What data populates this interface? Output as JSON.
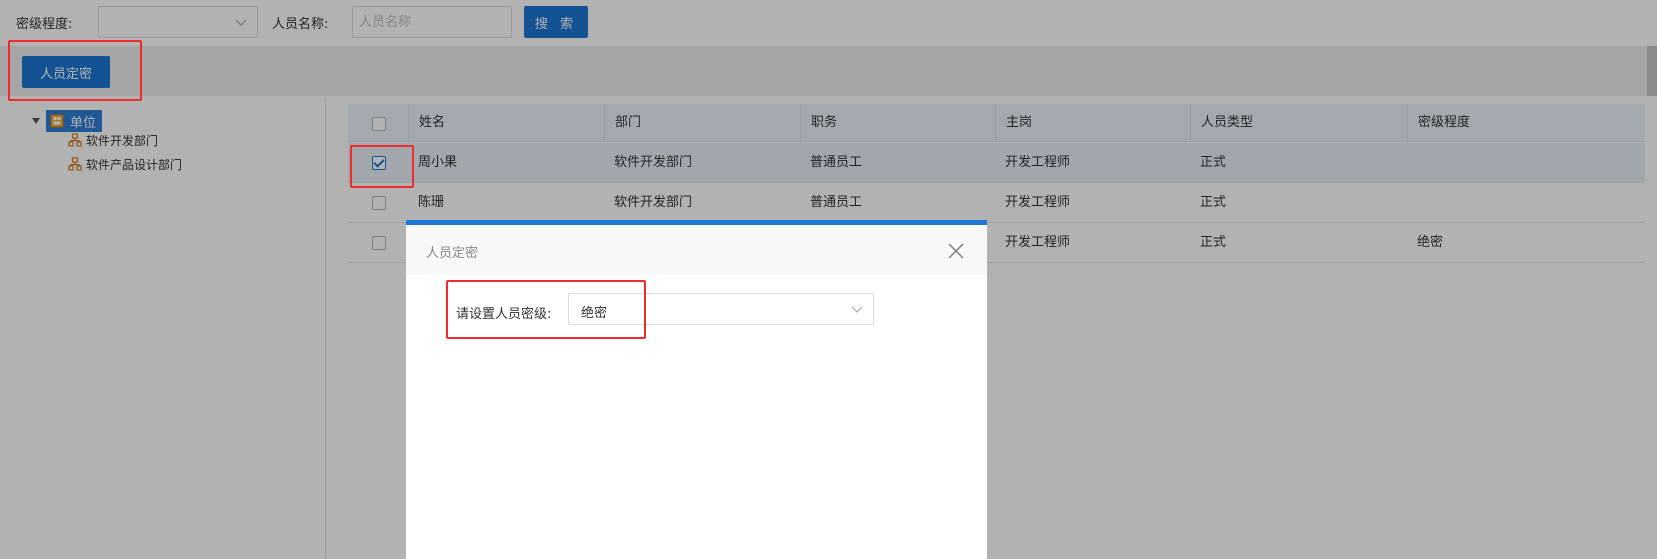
{
  "search": {
    "level_label": "密级程度:",
    "level_value": "",
    "name_label": "人员名称:",
    "name_placeholder": "人员名称",
    "search_button": "搜 索"
  },
  "toolbar": {
    "assign_button": "人员定密"
  },
  "tree": {
    "root_label": "单位",
    "children": [
      "软件开发部门",
      "软件产品设计部门"
    ]
  },
  "table": {
    "columns": [
      "姓名",
      "部门",
      "职务",
      "主岗",
      "人员类型",
      "密级程度"
    ],
    "rows": [
      {
        "checked": true,
        "cells": [
          "周小果",
          "软件开发部门",
          "普通员工",
          "开发工程师",
          "正式",
          ""
        ]
      },
      {
        "checked": false,
        "cells": [
          "陈珊",
          "软件开发部门",
          "普通员工",
          "开发工程师",
          "正式",
          ""
        ]
      },
      {
        "checked": false,
        "cells": [
          "",
          "",
          "",
          "开发工程师",
          "正式",
          "绝密"
        ]
      }
    ]
  },
  "modal": {
    "title": "人员定密",
    "field_label": "请设置人员密级:",
    "field_value": "绝密"
  },
  "colors": {
    "primary": "#1c78d4",
    "annotation_red": "#ef2b2b"
  },
  "icons": {
    "dropdown": "chevron-down-icon",
    "close": "close-icon",
    "tree_root": "organization-icon",
    "tree_child": "department-icon"
  }
}
